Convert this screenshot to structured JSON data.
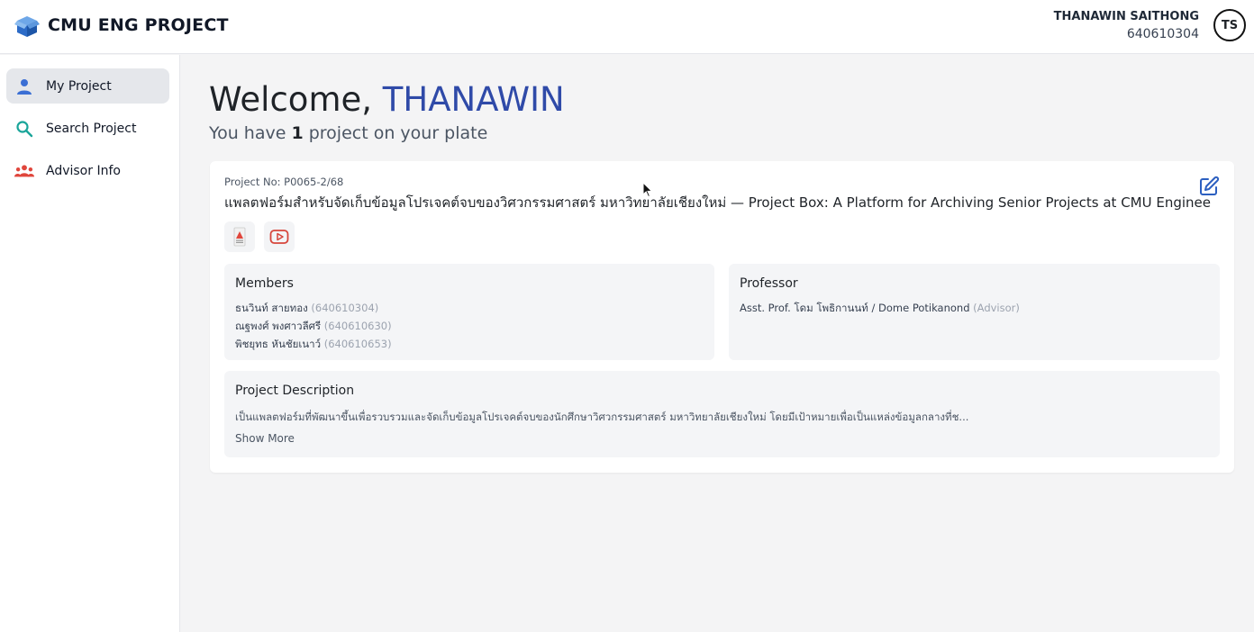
{
  "header": {
    "app_title": "CMU ENG PROJECT",
    "user_name": "THANAWIN SAITHONG",
    "user_id": "640610304",
    "avatar_initials": "TS"
  },
  "sidebar": {
    "items": [
      {
        "label": "My Project",
        "icon": "person-icon",
        "active": true
      },
      {
        "label": "Search Project",
        "icon": "search-icon"
      },
      {
        "label": "Advisor Info",
        "icon": "people-group-icon"
      }
    ]
  },
  "main": {
    "welcome_prefix": "Welcome, ",
    "welcome_name": "THANAWIN",
    "subtitle_prefix": "You have ",
    "project_count": "1",
    "subtitle_suffix": " project on your plate"
  },
  "project": {
    "number": "Project No: P0065-2/68",
    "title": "แพลตฟอร์มสำหรับจัดเก็บข้อมูลโปรเจคต์จบของวิศวกรรมศาสตร์ มหาวิทยาลัยเชียงใหม่ — Project Box: A Platform for Archiving Senior Projects at CMU Engineering",
    "attachments": [
      {
        "icon": "poster-icon"
      },
      {
        "icon": "youtube-icon"
      }
    ],
    "members_title": "Members",
    "members": [
      {
        "name": "ธนวินท์ สายทอง",
        "id": "(640610304)"
      },
      {
        "name": "ณฐพงศ์ พงศาวลีศรี",
        "id": "(640610630)"
      },
      {
        "name": "พิชยุทธ หันชัยเนาว์",
        "id": "(640610653)"
      }
    ],
    "professor_title": "Professor",
    "professor_name": "Asst. Prof. โดม โพธิกานนท์ / Dome Potikanond",
    "professor_role": "(Advisor)",
    "description_title": "Project Description",
    "description": "เป็นแพลตฟอร์มที่พัฒนาขึ้นเพื่อรวบรวมและจัดเก็บข้อมูลโปรเจคต์จบของนักศึกษาวิศวกรรมศาสตร์ มหาวิทยาลัยเชียงใหม่ โดยมีเป้าหมายเพื่อเป็นแหล่งข้อมูลกลางที่ช...",
    "show_more": "Show More"
  },
  "colors": {
    "accent": "#2f4aa8",
    "nav_person": "#3b6fd4",
    "nav_search": "#1aa59a",
    "nav_group": "#e0463c",
    "youtube": "#d6453b"
  }
}
